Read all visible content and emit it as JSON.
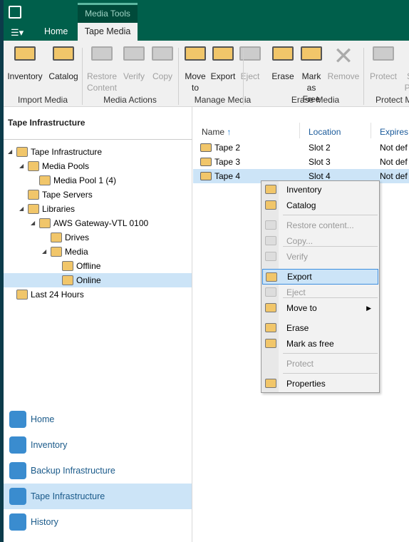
{
  "titlebar": {
    "context_tab": "Media Tools",
    "tabs": [
      "Home",
      "Tape Media"
    ],
    "active_tab": "Tape Media"
  },
  "ribbon": {
    "groups": [
      {
        "label": "Import Media",
        "buttons": [
          {
            "label": "Inventory",
            "enabled": true
          },
          {
            "label": "Catalog",
            "enabled": true
          }
        ]
      },
      {
        "label": "Media Actions",
        "buttons": [
          {
            "label": "Restore Content",
            "enabled": false
          },
          {
            "label": "Verify",
            "enabled": false
          },
          {
            "label": "Copy",
            "enabled": false
          }
        ]
      },
      {
        "label": "Manage Media",
        "buttons": [
          {
            "label": "Move to",
            "enabled": true
          },
          {
            "label": "Export",
            "enabled": true
          },
          {
            "label": "Eject",
            "enabled": false
          }
        ]
      },
      {
        "label": "Erase Media",
        "buttons": [
          {
            "label": "Erase",
            "enabled": true
          },
          {
            "label": "Mark as Free",
            "enabled": true
          },
          {
            "label": "Remove",
            "enabled": false
          }
        ]
      },
      {
        "label": "Protect M",
        "buttons": [
          {
            "label": "Protect",
            "enabled": false
          },
          {
            "label": "S Pa",
            "enabled": false
          }
        ]
      }
    ]
  },
  "left": {
    "header": "Tape Infrastructure",
    "tree": [
      {
        "label": "Tape Infrastructure",
        "level": 0,
        "expanded": true
      },
      {
        "label": "Media Pools",
        "level": 1,
        "expanded": true
      },
      {
        "label": "Media Pool 1 (4)",
        "level": 2
      },
      {
        "label": "Tape Servers",
        "level": 1
      },
      {
        "label": "Libraries",
        "level": 1,
        "expanded": true
      },
      {
        "label": "AWS Gateway-VTL 0100",
        "level": 2,
        "expanded": true
      },
      {
        "label": "Drives",
        "level": 3
      },
      {
        "label": "Media",
        "level": 3,
        "expanded": true
      },
      {
        "label": "Offline",
        "level": 4
      },
      {
        "label": "Online",
        "level": 4,
        "selected": true
      },
      {
        "label": "Last 24 Hours",
        "level": 0
      }
    ],
    "nav": [
      {
        "label": "Home"
      },
      {
        "label": "Inventory"
      },
      {
        "label": "Backup Infrastructure"
      },
      {
        "label": "Tape Infrastructure",
        "selected": true
      },
      {
        "label": "History"
      }
    ]
  },
  "table": {
    "columns": [
      "Name",
      "Location",
      "Expires"
    ],
    "sort_indicator": "↑",
    "rows": [
      {
        "name": "Tape 2",
        "location": "Slot 2",
        "expires": "Not def"
      },
      {
        "name": "Tape 3",
        "location": "Slot 3",
        "expires": "Not def"
      },
      {
        "name": "Tape 4",
        "location": "Slot 4",
        "expires": "Not def",
        "selected": true
      }
    ]
  },
  "context_menu": {
    "items": [
      {
        "label": "Inventory",
        "enabled": true
      },
      {
        "label": "Catalog",
        "enabled": true
      },
      {
        "label": "Restore content...",
        "enabled": false
      },
      {
        "label": "Copy...",
        "enabled": false
      },
      {
        "label": "Verify",
        "enabled": false
      },
      {
        "label": "Export",
        "enabled": true,
        "highlighted": true
      },
      {
        "label": "Eject",
        "enabled": false
      },
      {
        "label": "Move to",
        "enabled": true,
        "submenu": true
      },
      {
        "label": "Erase",
        "enabled": true
      },
      {
        "label": "Mark as free",
        "enabled": true
      },
      {
        "label": "Protect",
        "enabled": false
      },
      {
        "label": "Properties",
        "enabled": true
      }
    ]
  },
  "colors": {
    "titlebar": "#005f4b",
    "selection": "#cce4f7",
    "accent": "#3d8ee0"
  }
}
